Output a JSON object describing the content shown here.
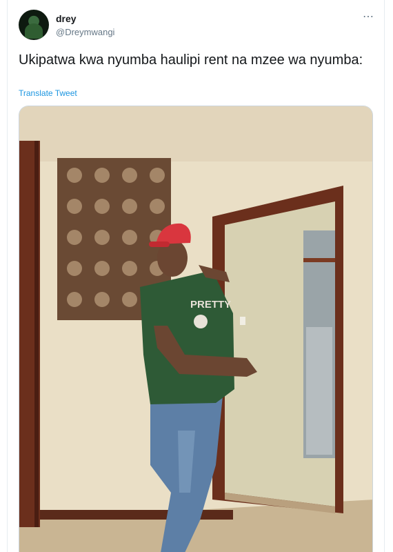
{
  "tweet": {
    "author_name": "drey",
    "author_handle": "@Dreymwangi",
    "text": "Ukipatwa kwa nyumba haulipi rent na mzee wa nyumba:",
    "translate_label": "Translate Tweet",
    "more_icon": "more-horizontal-icon"
  },
  "media": {
    "shirt_text": "PRETTY",
    "colors": {
      "wall": "#e8dcc0",
      "door_frame": "#6b2f1c",
      "cap": "#d9363e",
      "shirt": "#2e5a36",
      "jeans": "#5d7fa6",
      "floor": "#c8b592"
    }
  }
}
